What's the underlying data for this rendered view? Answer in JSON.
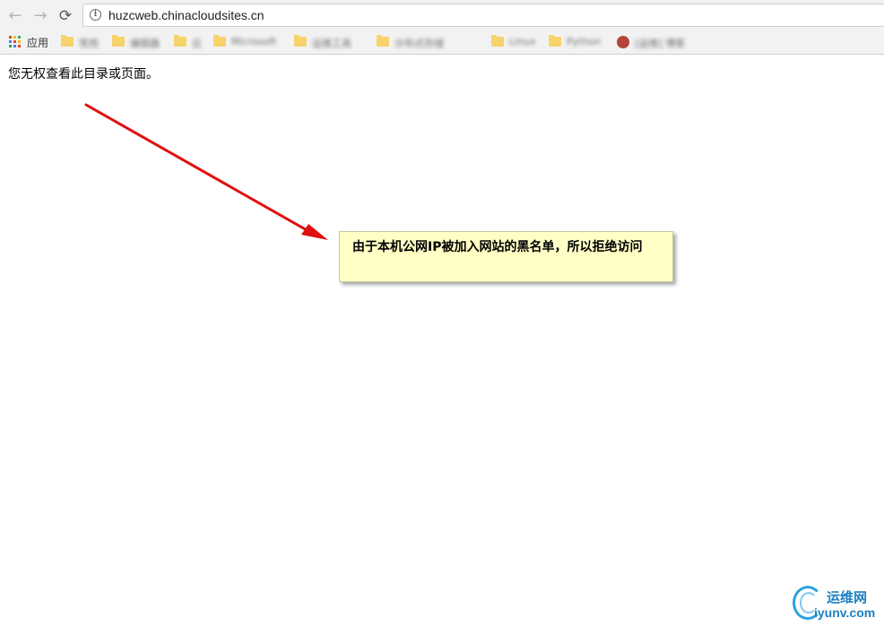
{
  "browser": {
    "nav": {
      "back_icon": "←",
      "forward_icon": "→",
      "reload_icon": "⟳"
    },
    "address_bar": {
      "url": "huzcweb.chinacloudsites.cn",
      "info_icon": "i"
    },
    "bookmarks": {
      "apps_label": "应用",
      "items": [
        {
          "label": "常用",
          "icon": "folder-icon"
        },
        {
          "label": "编辑器",
          "icon": "folder-icon"
        },
        {
          "label": "云",
          "icon": "folder-icon"
        },
        {
          "label": "Microsoft",
          "icon": "folder-icon"
        },
        {
          "label": "运维工具",
          "icon": "folder-icon"
        },
        {
          "label": "分布式存储",
          "icon": "folder-icon"
        },
        {
          "label": "Linux",
          "icon": "folder-icon"
        },
        {
          "label": "Python",
          "icon": "folder-icon"
        },
        {
          "label": "[运维] 博客",
          "icon": "site-favicon"
        }
      ]
    }
  },
  "page": {
    "message": "您无权查看此目录或页面。"
  },
  "annotation": {
    "callout_text": "由于本机公网IP被加入网站的黑名单，所以拒绝访问",
    "arrow_color": "#e01010",
    "callout_bg": "#ffffc6"
  },
  "watermark": {
    "cn": "运维网",
    "en": "iyunv.com"
  }
}
